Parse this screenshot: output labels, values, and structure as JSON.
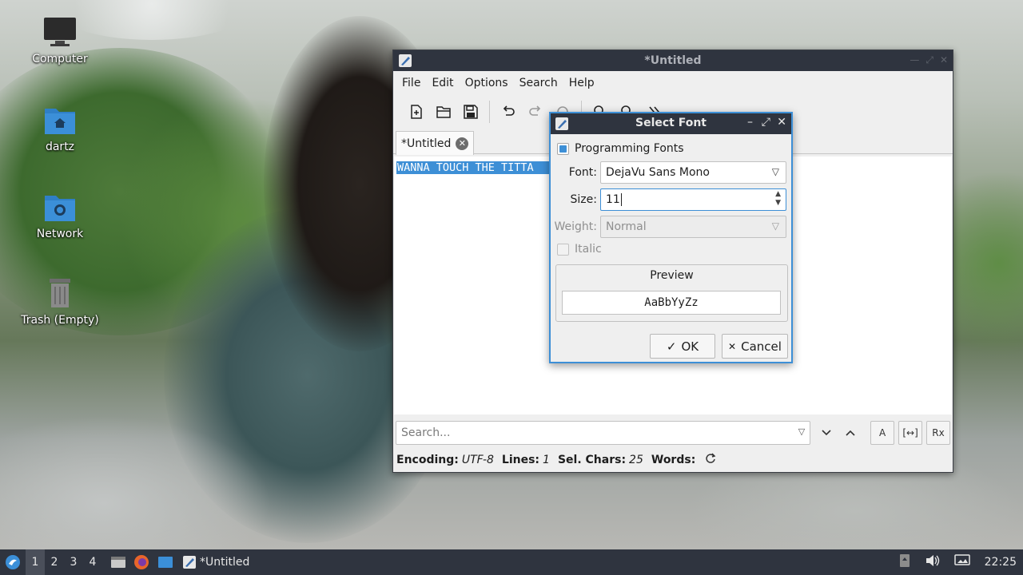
{
  "desktop": {
    "icons": [
      {
        "label": "Computer",
        "icon": "computer-icon"
      },
      {
        "label": "dartz",
        "icon": "home-folder-icon"
      },
      {
        "label": "Network",
        "icon": "network-folder-icon"
      },
      {
        "label": "Trash (Empty)",
        "icon": "trash-icon"
      }
    ]
  },
  "editor_window": {
    "title": "*Untitled",
    "menu": [
      "File",
      "Edit",
      "Options",
      "Search",
      "Help"
    ],
    "toolbar": [
      "new-document-icon",
      "open-folder-icon",
      "save-icon",
      "undo-icon",
      "redo-icon",
      "reload-icon",
      "find-icon",
      "find-replace-icon",
      "more-icon"
    ],
    "tab": {
      "label": "*Untitled",
      "close_glyph": "✕"
    },
    "text_line": "WANNA TOUCH THE TITTA",
    "search": {
      "placeholder": "Search..."
    },
    "search_buttons": {
      "match_case": "A",
      "whole_word": "[↔]",
      "regex": "Rx"
    },
    "status": {
      "encoding_label": "Encoding:",
      "encoding_value": "UTF-8",
      "lines_label": "Lines:",
      "lines_value": "1",
      "selchars_label": "Sel. Chars:",
      "selchars_value": "25",
      "words_label": "Words:"
    }
  },
  "font_dialog": {
    "title": "Select Font",
    "programming_fonts_label": "Programming Fonts",
    "programming_fonts_checked": true,
    "font_label": "Font:",
    "font_value": "DejaVu Sans Mono",
    "size_label": "Size:",
    "size_value": "11",
    "weight_label": "Weight:",
    "weight_value": "Normal",
    "italic_label": "Italic",
    "italic_checked": false,
    "preview_title": "Preview",
    "preview_sample": "AaBbYyZz",
    "ok_label": "OK",
    "cancel_label": "Cancel"
  },
  "taskbar": {
    "workspaces": [
      "1",
      "2",
      "3",
      "4"
    ],
    "active_workspace": "1",
    "task_label": "*Untitled",
    "clock": "22:25"
  },
  "colors": {
    "accent": "#3d8fd6",
    "titlebar": "#2f343f",
    "selection": "#3d8fd6"
  }
}
